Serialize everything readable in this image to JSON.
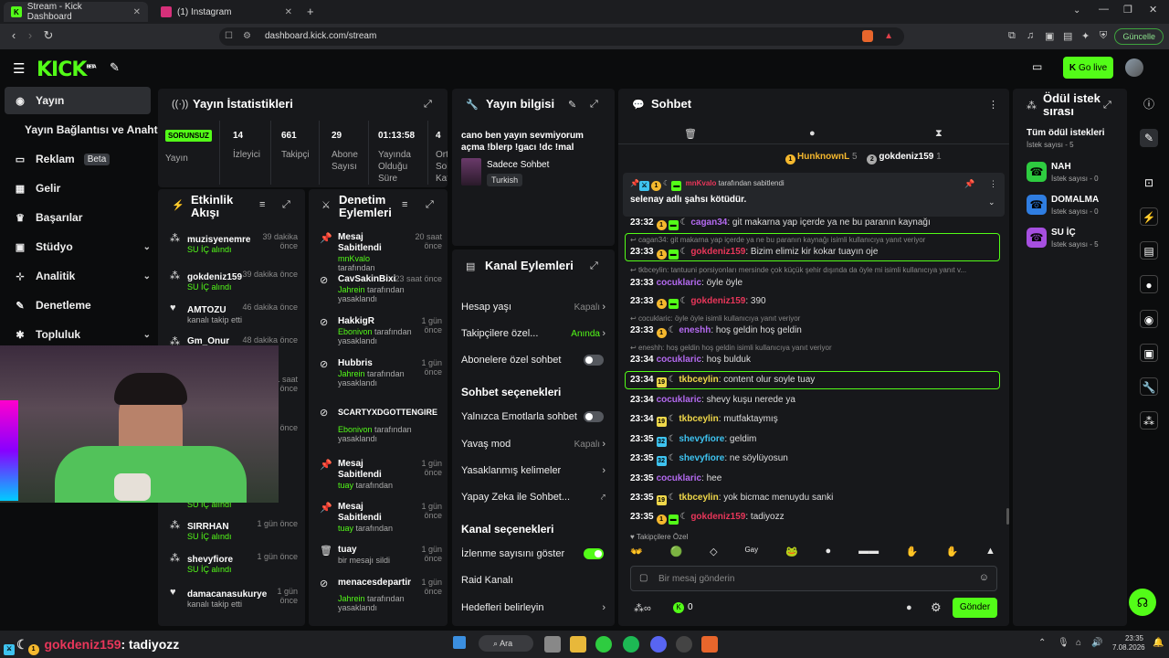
{
  "browser": {
    "tabs": [
      {
        "label": "Stream - Kick Dashboard"
      },
      {
        "label": "(1) Instagram"
      }
    ],
    "url": "dashboard.kick.com/stream",
    "update_label": "Güncelle"
  },
  "site": {
    "logo": "KICK",
    "logo_badge": "BETA",
    "go_live_label": "Go live"
  },
  "sidebar": {
    "items": [
      {
        "label": "Yayın"
      },
      {
        "label": "Yayın Bağlantısı ve Anahtarı"
      },
      {
        "label": "Reklam",
        "badge": "Beta"
      },
      {
        "label": "Gelir"
      },
      {
        "label": "Başarılar"
      },
      {
        "label": "Stüdyo"
      },
      {
        "label": "Analitik"
      },
      {
        "label": "Denetleme"
      },
      {
        "label": "Topluluk"
      }
    ]
  },
  "stats": {
    "title": "Yayın İstatistikleri",
    "status": "SORUNSUZ",
    "status_label": "Yayın",
    "items": [
      {
        "value": "14",
        "label": "İzleyici"
      },
      {
        "value": "661",
        "label": "Takipçi"
      },
      {
        "value": "29",
        "label": "Abone Sayısı"
      },
      {
        "value": "01:13:58",
        "label": "Yayında Olduğu Süre"
      },
      {
        "value": "4",
        "label": "Ort Sol Kat"
      }
    ]
  },
  "stream_info": {
    "title": "Yayın bilgisi",
    "stream_title": "cano ben yayın sevmiyorum açma !blerp !gacı !dc !mal",
    "category": "Sadece Sohbet",
    "language": "Turkish"
  },
  "activity": {
    "title": "Etkinlik Akışı",
    "items": [
      {
        "name": "muzisyenemre",
        "sub": "SU İÇ alındı",
        "time": "39 dakika önce"
      },
      {
        "name": "gokdeniz159",
        "sub": "SU İÇ alındı",
        "time": "39 dakika önce"
      },
      {
        "name": "AMTOZU",
        "sub": "kanalı takip etti",
        "time": "46 dakika önce"
      },
      {
        "name": "Gm_Onur",
        "sub": "",
        "time": "48 dakika önce"
      },
      {
        "name": "",
        "sub": "",
        "time": "1 saat önce"
      },
      {
        "name": "",
        "sub": "",
        "time": "önce"
      },
      {
        "name": "",
        "sub": "SU İÇ alındı",
        "time": ""
      },
      {
        "name": "SIRRHAN",
        "sub": "SU İÇ alındı",
        "time": "1 gün önce"
      },
      {
        "name": "shevyfiore",
        "sub": "SU İÇ alındı",
        "time": "1 gün önce"
      },
      {
        "name": "damacanasukurye",
        "sub": "kanalı takip etti",
        "time": "1 gün önce"
      }
    ]
  },
  "moderation": {
    "title": "Denetim Eylemleri",
    "items": [
      {
        "name": "Mesaj Sabitlendi",
        "actor": "mnKvalo",
        "sub": "tarafından",
        "time": "20 saat önce"
      },
      {
        "name": "CavSakinBixi",
        "actor": "Jahrein",
        "sub": "tarafından yasaklandı",
        "time": "23 saat önce"
      },
      {
        "name": "HakkigR",
        "actor": "Ebonivon",
        "sub": "tarafından yasaklandı",
        "time": "1 gün önce"
      },
      {
        "name": "Hubbris",
        "actor": "Jahrein",
        "sub": "tarafından yasaklandı",
        "time": "1 gün önce"
      },
      {
        "name": "SCARTYXDGOTTENGIRE",
        "actor": "Ebonivon",
        "sub": "tarafından yasaklandı",
        "time": ""
      },
      {
        "name": "Mesaj Sabitlendi",
        "actor": "tuay",
        "sub": "tarafından",
        "time": "1 gün önce"
      },
      {
        "name": "Mesaj Sabitlendi",
        "actor": "tuay",
        "sub": "tarafından",
        "time": "1 gün önce"
      },
      {
        "name": "tuay",
        "actor": "",
        "sub": "bir mesajı sildi",
        "time": "1 gün önce"
      },
      {
        "name": "menacesdepartir",
        "actor": "Jahrein",
        "sub": "tarafından yasaklandı",
        "time": "1 gün önce"
      }
    ]
  },
  "channel_actions": {
    "title": "Kanal Eylemleri",
    "rows": {
      "account_age": {
        "label": "Hesap yaşı",
        "value": "Kapalı"
      },
      "followers_only": {
        "label": "Takipçilere özel...",
        "value": "Anında"
      },
      "subs_only": {
        "label": "Abonelere özel sohbet"
      },
      "chat_options_title": "Sohbet seçenekleri",
      "emote_only": {
        "label": "Yalnızca Emotlarla sohbet"
      },
      "slow_mode": {
        "label": "Yavaş mod",
        "value": "Kapalı"
      },
      "banned_words": {
        "label": "Yasaklanmış kelimeler"
      },
      "ai_chat": {
        "label": "Yapay Zeka ile Sohbet..."
      },
      "channel_options_title": "Kanal seçenekleri",
      "show_viewers": {
        "label": "İzlenme sayısını göster"
      },
      "raid": {
        "label": "Raid Kanalı"
      },
      "goals": {
        "label": "Hedefleri belirleyin"
      }
    }
  },
  "chat": {
    "title": "Sohbet",
    "top_gifters": [
      {
        "name": "HunknownL",
        "count": "5"
      },
      {
        "name": "gokdeniz159",
        "count": "1"
      }
    ],
    "pinned": {
      "by": "mnKvalo",
      "by_suffix": "tarafından sabitlendi",
      "text": "selenay adlı şahsı kötüdür."
    },
    "messages": [
      {
        "time": "23:32",
        "user": "cagan34",
        "text": ": git makarna yap içerde ya ne bu paranın kaynağı",
        "color": "#b46af0"
      },
      {
        "reply": "cagan34: git makarna yap içerde ya ne bu paranın kaynağı isimli kullanıcıya yanıt veriyor"
      },
      {
        "time": "23:33",
        "user": "gokdeniz159",
        "text": ": Bizim elimiz kir kokar tuayın oje",
        "color": "#e8365a"
      },
      {
        "reply": "tkbceylin: tantuuni porsiyonları mersinde çok küçük şehir dışında da öyle mi isimli kullanıcıya yanıt v..."
      },
      {
        "time": "23:33",
        "user": "cocuklaric",
        "text": ": öyle öyle",
        "color": "#b46af0"
      },
      {
        "time": "23:33",
        "user": "gokdeniz159",
        "text": ": 390",
        "color": "#e8365a"
      },
      {
        "reply": "cocuklaric: öyle öyle isimli kullanıcıya yanıt veriyor"
      },
      {
        "time": "23:33",
        "user": "eneshh",
        "text": ": hoş geldin hoş geldin",
        "color": "#b46af0"
      },
      {
        "reply": "eneshh: hoş geldin hoş geldin isimli kullanıcıya yanıt veriyor"
      },
      {
        "time": "23:34",
        "user": "cocuklaric",
        "text": ": hoş bulduk",
        "color": "#b46af0"
      },
      {
        "time": "23:34",
        "user": "tkbceylin",
        "text": ": content olur soyle tuay",
        "color": "#f0d84a"
      },
      {
        "time": "23:34",
        "user": "cocuklaric",
        "text": ": shevy kuşu nerede ya",
        "color": "#b46af0"
      },
      {
        "time": "23:34",
        "user": "tkbceylin",
        "text": ": mutfaktaymış",
        "color": "#f0d84a"
      },
      {
        "time": "23:35",
        "user": "shevyfiore",
        "text": ": geldim",
        "color": "#3ec3f0"
      },
      {
        "time": "23:35",
        "user": "shevyfiore",
        "text": ": ne söylüyosun",
        "color": "#3ec3f0"
      },
      {
        "time": "23:35",
        "user": "cocuklaric",
        "text": ": hee",
        "color": "#b46af0"
      },
      {
        "time": "23:35",
        "user": "tkbceylin",
        "text": ": yok bicmac menuydu sanki",
        "color": "#f0d84a"
      },
      {
        "time": "23:35",
        "user": "gokdeniz159",
        "text": ": tadiyozz",
        "color": "#e8365a"
      }
    ],
    "followers_only_label": "Takipçilere Özel",
    "input_placeholder": "Bir mesaj gönderin",
    "kicks_count": "0",
    "send_label": "Gönder"
  },
  "rewards": {
    "title": "Ödül istek sırası",
    "all_label": "Tüm ödül istekleri",
    "all_count": "İstek sayısı - 5",
    "items": [
      {
        "name": "NAH",
        "count": "İstek sayısı - 0",
        "color": "#2ecc40"
      },
      {
        "name": "DOMALMA",
        "count": "İstek sayısı - 0",
        "color": "#2f7de1"
      },
      {
        "name": "SU İÇ",
        "count": "İstek sayısı - 5",
        "color": "#a64fe0"
      }
    ]
  },
  "overlay": {
    "user": "gokdeniz159",
    "text": ": tadiyozz"
  },
  "taskbar": {
    "search_label": "Ara",
    "time": "23:35",
    "date": "7.08.2026"
  }
}
